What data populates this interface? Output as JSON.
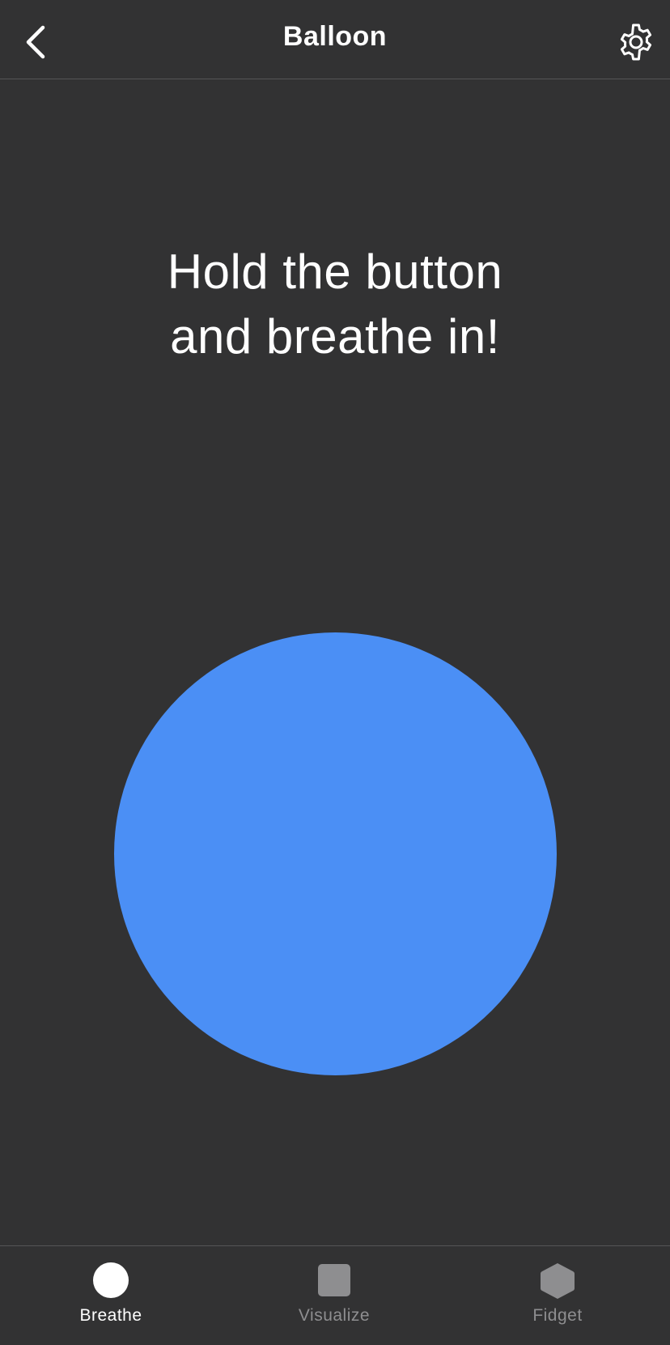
{
  "header": {
    "title": "Balloon",
    "back_icon": "chevron-left-icon",
    "settings_icon": "gear-icon"
  },
  "main": {
    "instruction_line1": "Hold the button",
    "instruction_line2": "and breathe in!",
    "balloon_color": "#4b8ff5"
  },
  "tabs": [
    {
      "label": "Breathe",
      "icon": "circle-icon",
      "active": true
    },
    {
      "label": "Visualize",
      "icon": "square-icon",
      "active": false
    },
    {
      "label": "Fidget",
      "icon": "hexagon-icon",
      "active": false
    }
  ],
  "colors": {
    "background": "#323233",
    "active_tab": "#ffffff",
    "inactive_tab": "#8e8e90"
  }
}
